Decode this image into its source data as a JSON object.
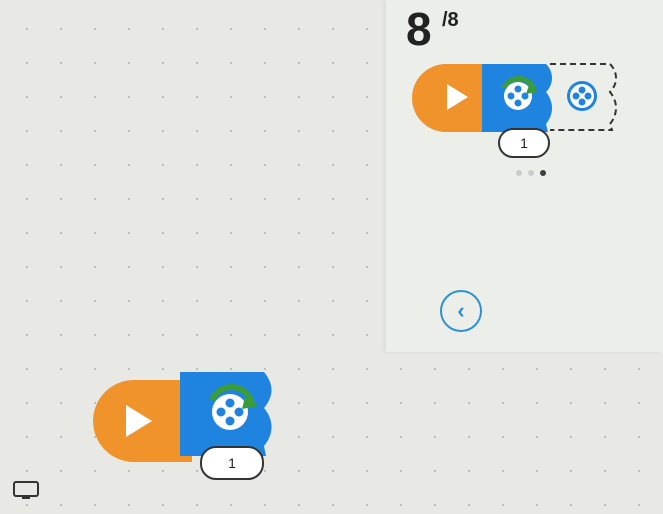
{
  "progress": {
    "current": "8",
    "total": "/8"
  },
  "carousel": {
    "dots": 3,
    "active_index": 2
  },
  "hint_program": {
    "blocks": [
      "start-block",
      "spin-motor-block",
      "motor-placeholder-block"
    ],
    "motor_count": "1"
  },
  "workspace_program": {
    "blocks": [
      "start-block",
      "spin-motor-block"
    ],
    "motor_count": "1"
  },
  "icons": {
    "back": "chevron-left-icon",
    "start": "play-icon",
    "motor": "motor-icon",
    "rotate": "rotate-arrow-icon",
    "device": "monitor-icon"
  },
  "colors": {
    "start_block": "#f0932b",
    "motor_block": "#1f84e0",
    "accent": "#2f91d4",
    "rotate_arrow": "#3a9c3a"
  }
}
